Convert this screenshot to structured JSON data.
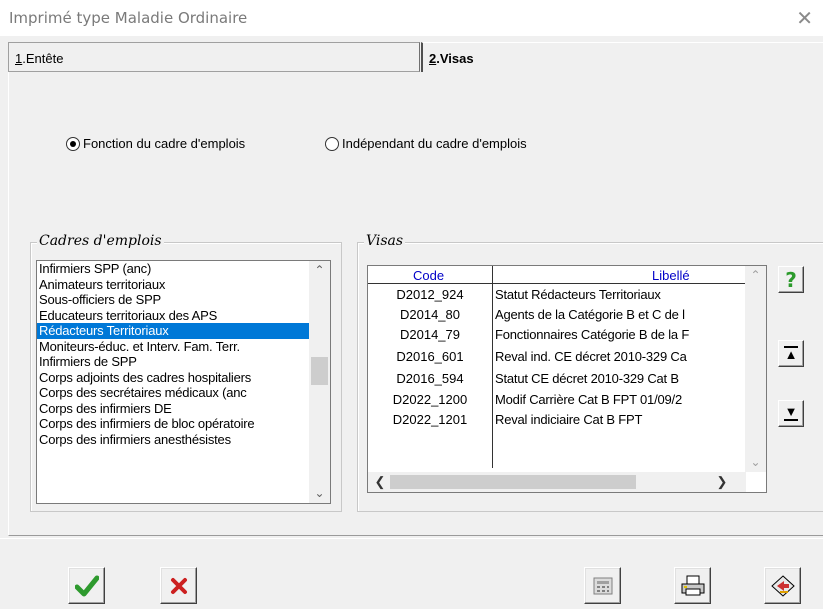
{
  "window": {
    "title": "Imprimé type Maladie Ordinaire",
    "close_glyph": "✕"
  },
  "tabs": [
    {
      "mnemonic": "1",
      "rest": ".Entête",
      "active": false
    },
    {
      "mnemonic": "2",
      "rest": ".Visas",
      "active": true
    }
  ],
  "radios": [
    {
      "label": "Fonction du cadre d'emplois",
      "selected": true
    },
    {
      "label": "Indépendant du cadre d'emplois",
      "selected": false
    }
  ],
  "cadres": {
    "legend": "Cadres d'emplois",
    "items": [
      "Infirmiers SPP (anc)",
      "Animateurs territoriaux",
      "Sous-officiers de SPP",
      "Educateurs territoriaux des APS",
      "Rédacteurs Territoriaux",
      "Moniteurs-éduc. et Interv. Fam. Terr.",
      "Infirmiers de SPP",
      "Corps adjoints des cadres hospitaliers",
      "Corps des secrétaires médicaux (anc",
      "Corps des infirmiers DE",
      "Corps des infirmiers de bloc opératoire",
      "Corps des infirmiers anesthésistes"
    ],
    "selected_index": 4
  },
  "visas": {
    "legend": "Visas",
    "columns": {
      "code": "Code",
      "libelle": "Libellé"
    },
    "rows": [
      {
        "code": "D2012_924",
        "libelle": "Statut Rédacteurs Territoriaux"
      },
      {
        "code": "D2014_80",
        "libelle": "Agents de la Catégorie B et C de l"
      },
      {
        "code": "D2014_79",
        "libelle": "Fonctionnaires Catégorie B de la F"
      },
      {
        "code": "D2016_601",
        "libelle": "Reval ind. CE décret 2010-329 Ca"
      },
      {
        "code": "D2016_594",
        "libelle": "Statut CE décret 2010-329 Cat B"
      },
      {
        "code": "D2022_1200",
        "libelle": "Modif Carrière Cat B FPT 01/09/2"
      },
      {
        "code": "D2022_1201",
        "libelle": "Reval indiciaire Cat B FPT"
      }
    ]
  },
  "side_buttons": {
    "help": "?",
    "move_up": "▲",
    "move_down": "▼"
  },
  "scroll_glyphs": {
    "up": "⌃",
    "down": "⌄",
    "left": "❮",
    "right": "❯"
  },
  "colors": {
    "selection": "#0078d7",
    "header_text": "#0000c8",
    "help_green": "#2b9a2b",
    "ok_green": "#2e9a2e",
    "cancel_red": "#cc2020"
  }
}
